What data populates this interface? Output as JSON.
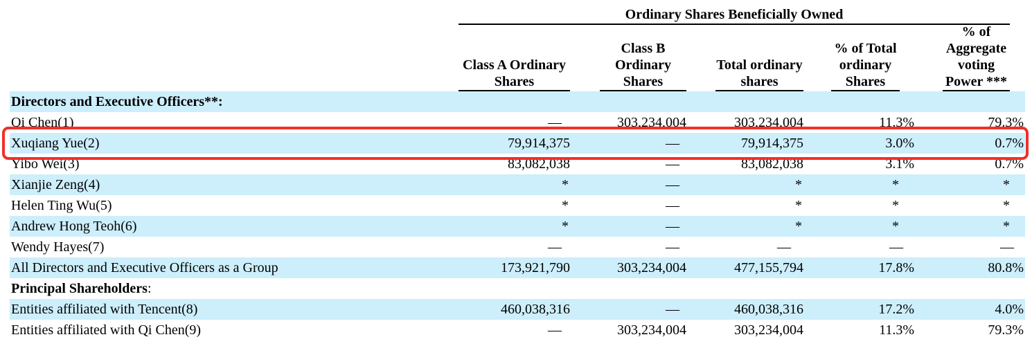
{
  "table": {
    "group_header": "Ordinary Shares Beneficially Owned",
    "columns": [
      "Class A Ordinary Shares",
      "Class B Ordinary Shares",
      "Total ordinary shares",
      "% of Total ordinary Shares",
      "% of Aggregate voting Power ***"
    ],
    "rows": [
      {
        "label": "Directors and Executive Officers**:",
        "section": true,
        "values": [
          "",
          "",
          "",
          "",
          ""
        ]
      },
      {
        "label": "Qi Chen(1)",
        "values": [
          "—",
          "303,234,004",
          "303,234,004",
          "11.3%",
          "79.3%"
        ]
      },
      {
        "label": "Xuqiang Yue(2)",
        "values": [
          "79,914,375",
          "—",
          "79,914,375",
          "3.0%",
          "0.7%"
        ],
        "highlighted": true
      },
      {
        "label": "Yibo Wei(3)",
        "values": [
          "83,082,038",
          "—",
          "83,082,038",
          "3.1%",
          "0.7%"
        ]
      },
      {
        "label": "Xianjie Zeng(4)",
        "values": [
          "*",
          "—",
          "*",
          "*",
          "*"
        ]
      },
      {
        "label": "Helen Ting Wu(5)",
        "values": [
          "*",
          "—",
          "*",
          "*",
          "*"
        ]
      },
      {
        "label": "Andrew Hong Teoh(6)",
        "values": [
          "*",
          "—",
          "*",
          "*",
          "*"
        ]
      },
      {
        "label": "Wendy Hayes(7)",
        "values": [
          "—",
          "—",
          "—",
          "—",
          "—"
        ]
      },
      {
        "label": "All Directors and Executive Officers as a Group",
        "values": [
          "173,921,790",
          "303,234,004",
          "477,155,794",
          "17.8%",
          "80.8%"
        ]
      },
      {
        "label": "Principal Shareholders",
        "label_suffix": ":",
        "section": true,
        "values": [
          "",
          "",
          "",
          "",
          ""
        ]
      },
      {
        "label": "Entities affiliated with Tencent(8)",
        "values": [
          "460,038,316",
          "—",
          "460,038,316",
          "17.2%",
          "4.0%"
        ]
      },
      {
        "label": "Entities affiliated with Qi Chen(9)",
        "values": [
          "—",
          "303,234,004",
          "303,234,004",
          "11.3%",
          "79.3%"
        ]
      }
    ]
  },
  "colors": {
    "row_stripe": "#cdeefb",
    "highlight_border": "#f0302a"
  }
}
